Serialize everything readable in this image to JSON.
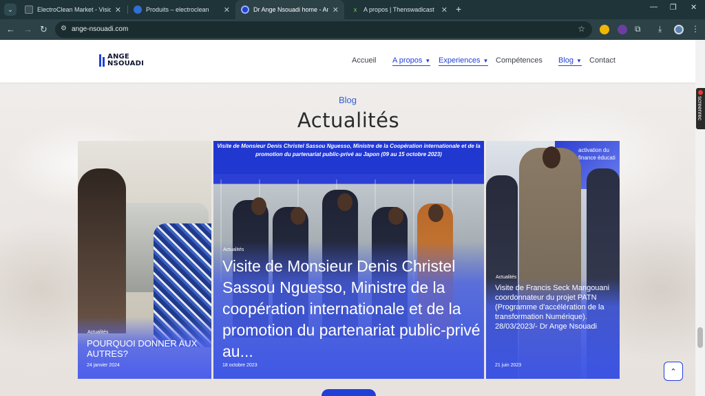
{
  "browser": {
    "tabs": [
      {
        "title": "ElectroClean Market - Vision M",
        "active": false
      },
      {
        "title": "Produits – electroclean",
        "active": false
      },
      {
        "title": "Dr Ange Nsouadi home - Ange",
        "active": true
      },
      {
        "title": "A propos | Thenswadicast",
        "active": false
      }
    ],
    "new_tab": "+",
    "url": "ange-nsouadi.com",
    "extension_badge_1": "1",
    "extension_badge_2": "24"
  },
  "site": {
    "logo_line1": "ANGE",
    "logo_line2": "NSOUADI",
    "nav": [
      {
        "label": "Accueil",
        "active": false,
        "dropdown": false
      },
      {
        "label": "A propos",
        "active": true,
        "dropdown": true
      },
      {
        "label": "Experiences",
        "active": true,
        "dropdown": true
      },
      {
        "label": "Compétences",
        "active": false,
        "dropdown": false
      },
      {
        "label": "Blog",
        "active": true,
        "dropdown": true
      },
      {
        "label": "Contact",
        "active": false,
        "dropdown": false
      }
    ],
    "eyebrow": "Blog",
    "heading": "Actualités",
    "posts": [
      {
        "category": "Actualités",
        "title": "POURQUOI DONNER AUX AUTRES?",
        "date": "24 janvier 2024"
      },
      {
        "category": "Actualités",
        "banner": "Visite de Monsieur Denis Christel Sassou Nguesso, Ministre de la Coopération internationale et de la promotion du partenariat public-privé au Japon (09 au 15 octobre 2023)",
        "title": "Visite de Monsieur Denis Christel Sassou Nguesso, Ministre de la coopération internationale et de la promotion du partenariat public-privé au...",
        "date": "18 octobre 2023"
      },
      {
        "category": "Actualités",
        "photo_text": "activation du finance éducati",
        "title": "Visite de Francis Seck Mangouani coordonnateur du projet PATN (Programme d'accélération de la transformation Numérique). 28/03/2023/- Dr Ange Nsouadi",
        "date": "21 juin 2023"
      }
    ]
  },
  "screenrec_label": "screenrec",
  "colors": {
    "brand_blue": "#1f3fd6",
    "chrome_dark": "#1f3438",
    "chrome_toolbar": "#2c4247"
  }
}
